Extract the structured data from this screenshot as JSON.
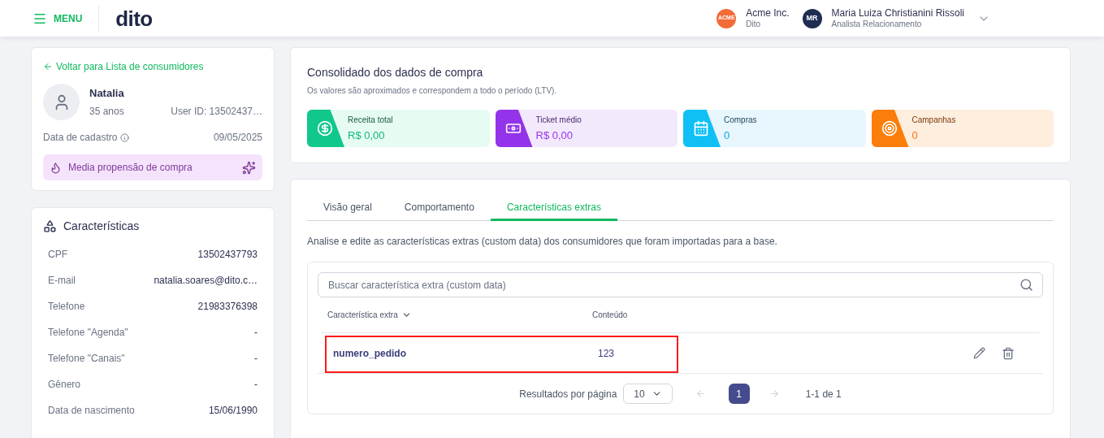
{
  "header": {
    "menu_label": "MENU",
    "logo": "dito",
    "organization": {
      "badge": "ACME",
      "name": "Acme Inc.",
      "subtitle": "Dito"
    },
    "user": {
      "initials": "MR",
      "name": "Maria Luiza Christianini Rissoli",
      "role": "Analista Relacionamento"
    }
  },
  "profile": {
    "back_link": "Voltar para Lista de consumidores",
    "name": "Natalia",
    "age": "35 anos",
    "user_id": "User ID: 13502437…",
    "registration_label": "Data de cadastro",
    "registration_date": "09/05/2025",
    "propensity": "Media propensão de compra"
  },
  "characteristics": {
    "title": "Características",
    "rows": [
      {
        "label": "CPF",
        "value": "13502437793"
      },
      {
        "label": "E-mail",
        "value": "natalia.soares@dito.c…"
      },
      {
        "label": "Telefone",
        "value": "21983376398"
      },
      {
        "label": "Telefone \"Agenda\"",
        "value": "-"
      },
      {
        "label": "Telefone \"Canais\"",
        "value": "-"
      },
      {
        "label": "Gênero",
        "value": "-"
      },
      {
        "label": "Data de nascimento",
        "value": "15/06/1990"
      }
    ]
  },
  "summary": {
    "title": "Consolidado dos dados de compra",
    "subtitle": "Os valores são aproximados e correspondem a todo o período (LTV).",
    "stats": [
      {
        "kind": "revenue",
        "label": "Receita total",
        "value": "R$ 0,00"
      },
      {
        "kind": "ticket",
        "label": "Ticket médio",
        "value": "R$ 0,00"
      },
      {
        "kind": "purchases",
        "label": "Compras",
        "value": "0"
      },
      {
        "kind": "campaigns",
        "label": "Campanhas",
        "value": "0"
      }
    ]
  },
  "tabs": [
    {
      "label": "Visão geral",
      "selected": false
    },
    {
      "label": "Comportamento",
      "selected": false
    },
    {
      "label": "Características extras",
      "selected": true
    }
  ],
  "description": "Analise e edite as características extras (custom data) dos consumidores que foram importadas para a base.",
  "search": {
    "placeholder": "Buscar característica extra (custom data)"
  },
  "table": {
    "columns": [
      "Característica extra",
      "Conteúdo"
    ],
    "rows": [
      {
        "name": "numero_pedido",
        "content": "123",
        "highlighted": true
      }
    ]
  },
  "pagination": {
    "label": "Resultados por página",
    "per_page": "10",
    "pages": [
      {
        "label": "1",
        "selected": true
      }
    ],
    "range": "1-1 de 1"
  }
}
